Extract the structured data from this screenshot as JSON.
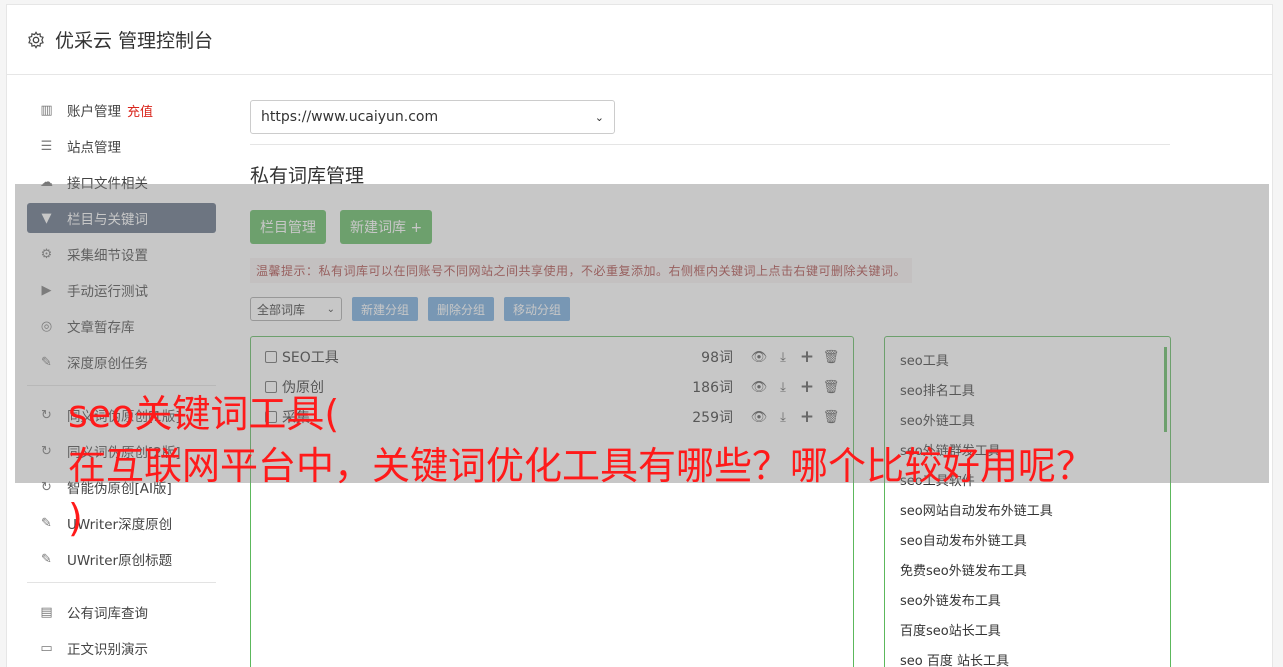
{
  "app": {
    "title": "优采云 管理控制台"
  },
  "sidebar": {
    "items": [
      {
        "label": "账户管理",
        "badge": "充值",
        "icon": "bar-chart-icon"
      },
      {
        "label": "站点管理",
        "icon": "server-icon"
      },
      {
        "label": "接口文件相关",
        "icon": "cloud-upload-icon"
      },
      {
        "label": "栏目与关键词",
        "icon": "filter-icon",
        "active": true
      },
      {
        "label": "采集细节设置",
        "icon": "cogs-icon"
      },
      {
        "label": "手动运行测试",
        "icon": "play-icon"
      },
      {
        "label": "文章暂存库",
        "icon": "database-icon"
      },
      {
        "label": "深度原创任务",
        "icon": "edit-icon"
      }
    ],
    "items2": [
      {
        "label": "同义词伪原创[1版]",
        "icon": "refresh-icon"
      },
      {
        "label": "同义词伪原创[2版]",
        "icon": "refresh-icon"
      },
      {
        "label": "智能伪原创[AI版]",
        "icon": "refresh-icon"
      },
      {
        "label": "UWriter深度原创",
        "icon": "edit-icon"
      },
      {
        "label": "UWriter原创标题",
        "icon": "edit-icon"
      }
    ],
    "items3": [
      {
        "label": "公有词库查询",
        "icon": "book-icon"
      },
      {
        "label": "正文识别演示",
        "icon": "monitor-icon"
      }
    ]
  },
  "main": {
    "site_select": "https://www.ucaiyun.com",
    "section_title": "私有词库管理",
    "btn_columns": "栏目管理",
    "btn_new_lib": "新建词库 +",
    "tip": "温馨提示：私有词库可以在同账号不同网站之间共享使用，不必重复添加。右侧框内关键词上点击右键可删除关键词。",
    "filter_select": "全部词库",
    "btn_new_group": "新建分组",
    "btn_delete_group": "删除分组",
    "btn_move_group": "移动分组",
    "libraries": [
      {
        "name": "SEO工具",
        "count": "98词"
      },
      {
        "name": "伪原创",
        "count": "186词"
      },
      {
        "name": "采集",
        "count": "259词"
      }
    ],
    "keywords": [
      "seo工具",
      "seo排名工具",
      "seo外链工具",
      "seo外链群发工具",
      "seo工具软件",
      "seo网站自动发布外链工具",
      "seo自动发布外链工具",
      "免费seo外链发布工具",
      "seo外链发布工具",
      "百度seo站长工具",
      "seo 百度 站长工具"
    ]
  },
  "overlay": {
    "line1": "seo关键词工具(",
    "line2": "在互联网平台中，关键词优化工具有哪些？哪个比较好用呢？",
    "line3": ")"
  },
  "colors": {
    "accent_green": "#5cb85c",
    "active_nav": "#5b6a80",
    "headline_red": "#ff1a1a"
  }
}
